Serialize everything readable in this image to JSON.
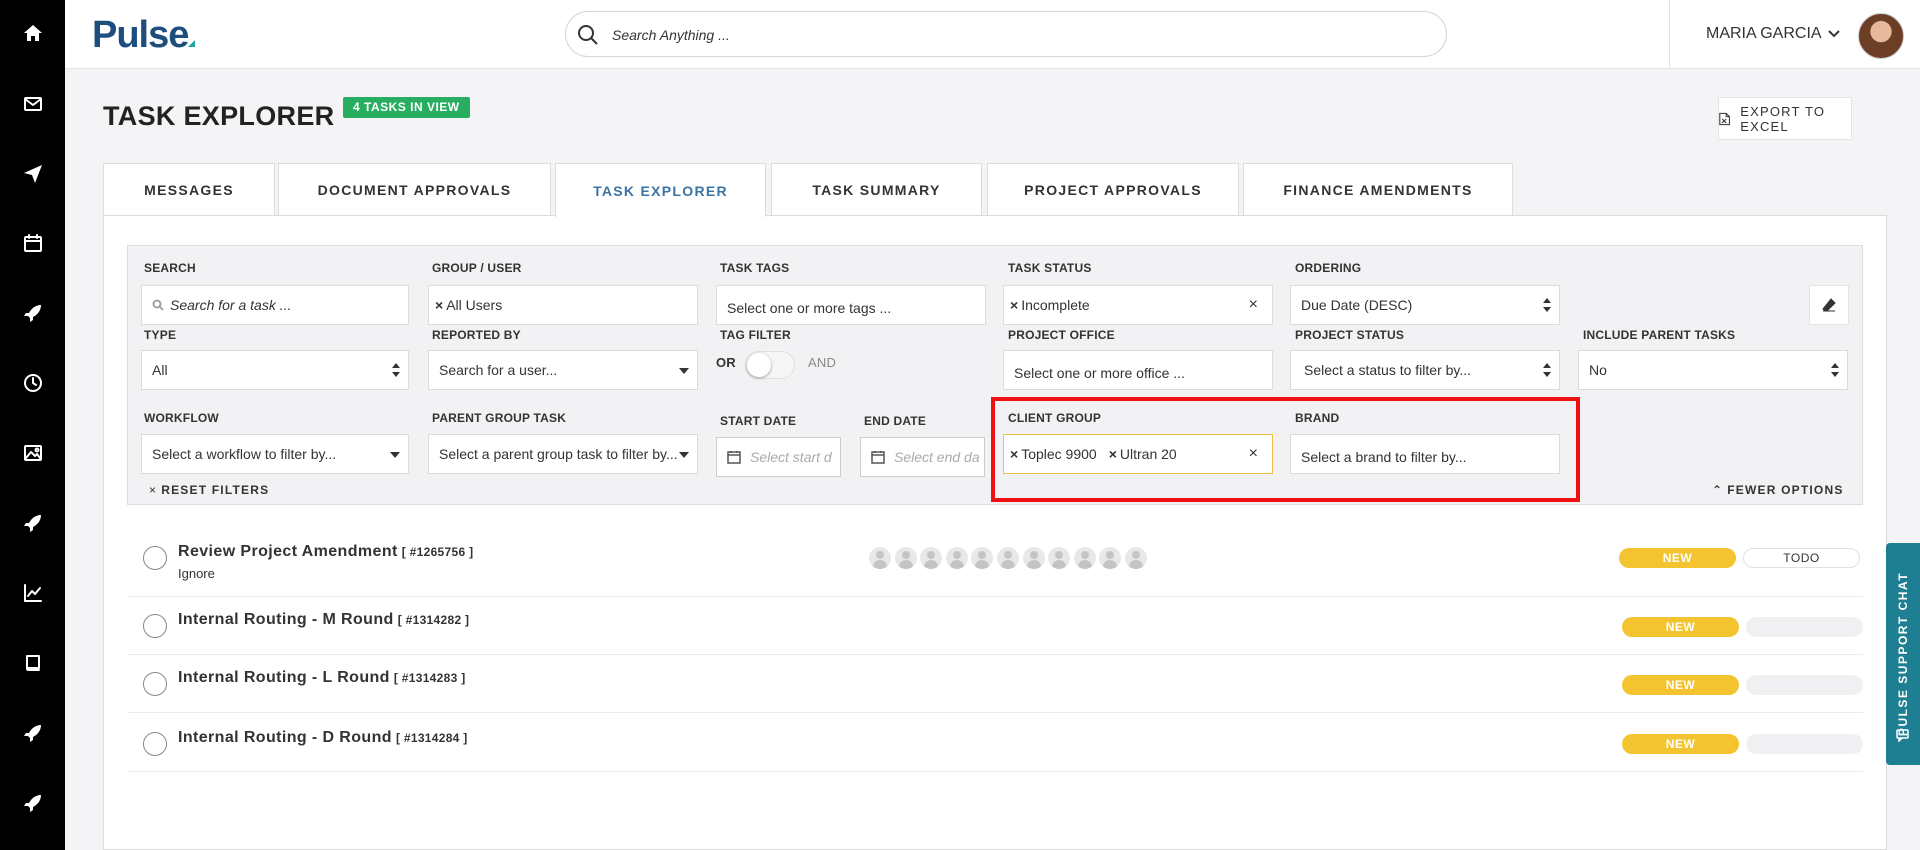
{
  "header": {
    "logo": "Pulse",
    "search_placeholder": "Search Anything ...",
    "user_name": "MARIA GARCIA"
  },
  "sidebar": {
    "icons": [
      "home-icon",
      "mail-icon",
      "send-icon",
      "calendar-icon",
      "rocket-icon",
      "clock-icon",
      "image-icon",
      "rocket-icon",
      "chart-icon",
      "book-icon",
      "rocket-icon",
      "rocket-icon"
    ]
  },
  "page": {
    "title": "TASK EXPLORER",
    "count_badge": "4 TASKS IN VIEW",
    "export_label": "EXPORT TO EXCEL"
  },
  "tabs": [
    {
      "label": "MESSAGES",
      "active": false
    },
    {
      "label": "DOCUMENT APPROVALS",
      "active": false
    },
    {
      "label": "TASK EXPLORER",
      "active": true
    },
    {
      "label": "TASK SUMMARY",
      "active": false
    },
    {
      "label": "PROJECT APPROVALS",
      "active": false
    },
    {
      "label": "FINANCE AMENDMENTS",
      "active": false
    }
  ],
  "filters": {
    "search": {
      "label": "SEARCH",
      "placeholder": "Search for a task ..."
    },
    "group_user": {
      "label": "GROUP / USER",
      "chip": "All Users"
    },
    "task_tags": {
      "label": "TASK TAGS",
      "placeholder": "Select one or more tags ..."
    },
    "task_status": {
      "label": "TASK STATUS",
      "chip": "Incomplete"
    },
    "ordering": {
      "label": "ORDERING",
      "value": "Due Date (DESC)"
    },
    "type": {
      "label": "TYPE",
      "value": "All"
    },
    "reported_by": {
      "label": "REPORTED BY",
      "placeholder": "Search for a user..."
    },
    "tag_filter": {
      "label": "TAG FILTER",
      "or_label": "OR",
      "and_label": "AND"
    },
    "project_office": {
      "label": "PROJECT OFFICE",
      "placeholder": "Select one or more office ..."
    },
    "project_status": {
      "label": "PROJECT STATUS",
      "placeholder": "Select a status to filter by..."
    },
    "include_parent_tasks": {
      "label": "INCLUDE PARENT TASKS",
      "value": "No"
    },
    "workflow": {
      "label": "WORKFLOW",
      "placeholder": "Select a workflow to filter by..."
    },
    "parent_group_task": {
      "label": "PARENT GROUP TASK",
      "placeholder": "Select a parent group task to filter by..."
    },
    "start_date": {
      "label": "START DATE",
      "placeholder": "Select start d"
    },
    "end_date": {
      "label": "END DATE",
      "placeholder": "Select end da"
    },
    "client_group": {
      "label": "CLIENT GROUP",
      "chips": [
        "Toplec 9900",
        "Ultran 20"
      ]
    },
    "brand": {
      "label": "BRAND",
      "placeholder": "Select a brand to filter by..."
    },
    "reset_label": "RESET FILTERS",
    "fewer_options_label": "FEWER OPTIONS"
  },
  "tasks": [
    {
      "title": "Review Project Amendment",
      "id": "[ #1265756 ]",
      "subtitle": "Ignore",
      "status": "NEW",
      "stage": "TODO",
      "assignee_count": 11
    },
    {
      "title": "Internal Routing - M Round",
      "id": "[ #1314282 ]",
      "subtitle": "",
      "status": "NEW",
      "stage": ""
    },
    {
      "title": "Internal Routing - L Round",
      "id": "[ #1314283 ]",
      "subtitle": "",
      "status": "NEW",
      "stage": ""
    },
    {
      "title": "Internal Routing - D Round",
      "id": "[ #1314284 ]",
      "subtitle": "",
      "status": "NEW",
      "stage": ""
    }
  ],
  "support_chat_label": "PULSE SUPPORT CHAT",
  "colors": {
    "sidebar": "#000000",
    "brand_blue": "#1d4e7e",
    "badge_green": "#27ae60",
    "status_new": "#f4c430",
    "highlight": "#ee1111",
    "support_chat": "#1f7f92",
    "active_tab": "#3a73a5"
  }
}
